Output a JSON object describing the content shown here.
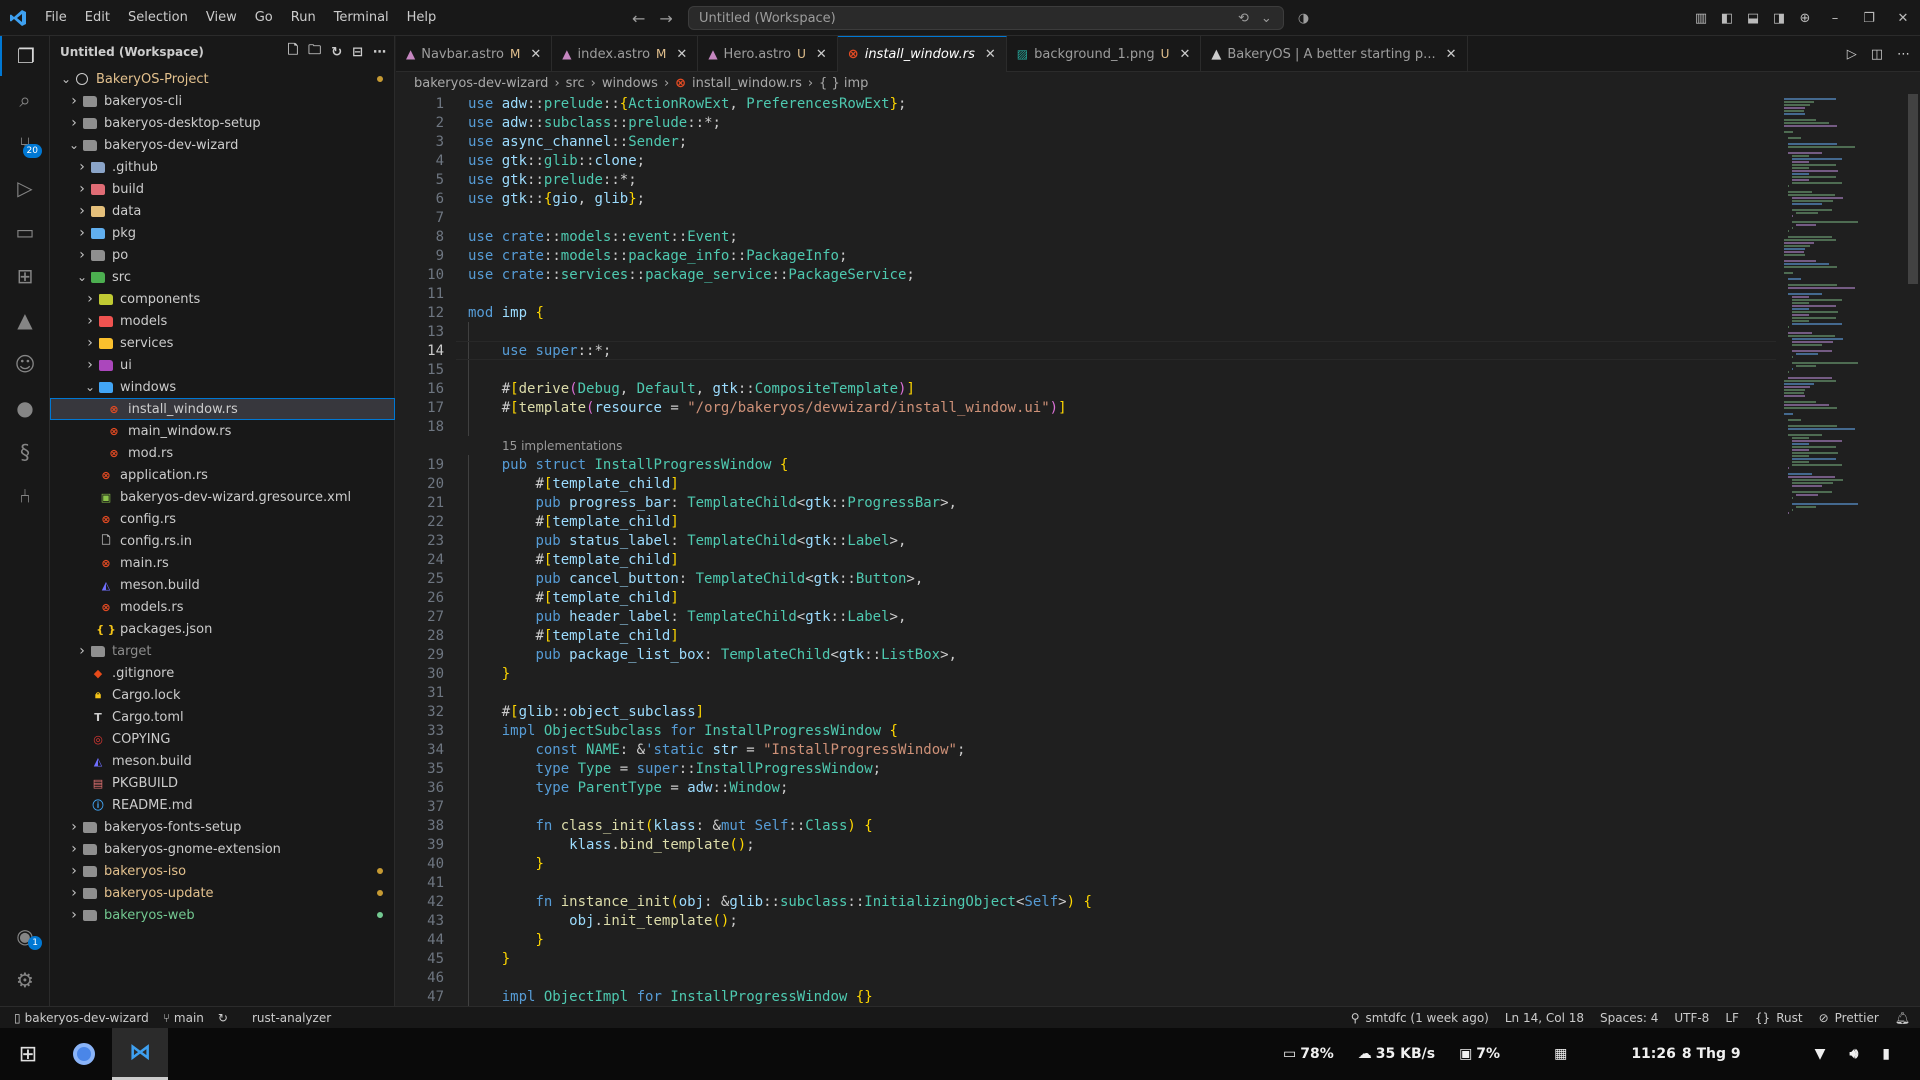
{
  "titlebar": {
    "menus": [
      "File",
      "Edit",
      "Selection",
      "View",
      "Go",
      "Run",
      "Terminal",
      "Help"
    ],
    "command_center": "Untitled (Workspace)"
  },
  "activity": {
    "source_control_badge": "20",
    "account_badge": "1"
  },
  "sidebar": {
    "title": "Untitled (Workspace)",
    "tree": [
      {
        "label": "BakeryOS-Project",
        "depth": 0,
        "kind": "root",
        "open": true,
        "color": "#e2c08d",
        "dot": true
      },
      {
        "label": "bakeryos-cli",
        "depth": 1,
        "kind": "folder",
        "open": false
      },
      {
        "label": "bakeryos-desktop-setup",
        "depth": 1,
        "kind": "folder",
        "open": false
      },
      {
        "label": "bakeryos-dev-wizard",
        "depth": 1,
        "kind": "folder",
        "open": true
      },
      {
        "label": ".github",
        "depth": 2,
        "kind": "folder",
        "open": false,
        "fcolor": "#8aa4c8"
      },
      {
        "label": "build",
        "depth": 2,
        "kind": "folder",
        "open": false,
        "fcolor": "#e06c75"
      },
      {
        "label": "data",
        "depth": 2,
        "kind": "folder",
        "open": false,
        "fcolor": "#e5c07b"
      },
      {
        "label": "pkg",
        "depth": 2,
        "kind": "folder",
        "open": false,
        "fcolor": "#61afef"
      },
      {
        "label": "po",
        "depth": 2,
        "kind": "folder",
        "open": false
      },
      {
        "label": "src",
        "depth": 2,
        "kind": "folder",
        "open": true,
        "fcolor": "#4caf50"
      },
      {
        "label": "components",
        "depth": 3,
        "kind": "folder",
        "open": false,
        "fcolor": "#c0ca33"
      },
      {
        "label": "models",
        "depth": 3,
        "kind": "folder",
        "open": false,
        "fcolor": "#ef5350"
      },
      {
        "label": "services",
        "depth": 3,
        "kind": "folder",
        "open": false,
        "fcolor": "#fbc02d"
      },
      {
        "label": "ui",
        "depth": 3,
        "kind": "folder",
        "open": false,
        "fcolor": "#ab47bc"
      },
      {
        "label": "windows",
        "depth": 3,
        "kind": "folder",
        "open": true,
        "fcolor": "#42a5f5"
      },
      {
        "label": "install_window.rs",
        "depth": 4,
        "kind": "rs",
        "selected": true
      },
      {
        "label": "main_window.rs",
        "depth": 4,
        "kind": "rs"
      },
      {
        "label": "mod.rs",
        "depth": 4,
        "kind": "rs"
      },
      {
        "label": "application.rs",
        "depth": 3,
        "kind": "rs"
      },
      {
        "label": "bakeryos-dev-wizard.gresource.xml",
        "depth": 3,
        "kind": "xml"
      },
      {
        "label": "config.rs",
        "depth": 3,
        "kind": "rs"
      },
      {
        "label": "config.rs.in",
        "depth": 3,
        "kind": "file"
      },
      {
        "label": "main.rs",
        "depth": 3,
        "kind": "rs"
      },
      {
        "label": "meson.build",
        "depth": 3,
        "kind": "meson"
      },
      {
        "label": "models.rs",
        "depth": 3,
        "kind": "rs"
      },
      {
        "label": "packages.json",
        "depth": 3,
        "kind": "json"
      },
      {
        "label": "target",
        "depth": 2,
        "kind": "folder",
        "open": false,
        "dim": true
      },
      {
        "label": ".gitignore",
        "depth": 2,
        "kind": "git"
      },
      {
        "label": "Cargo.lock",
        "depth": 2,
        "kind": "lock"
      },
      {
        "label": "Cargo.toml",
        "depth": 2,
        "kind": "toml"
      },
      {
        "label": "COPYING",
        "depth": 2,
        "kind": "license"
      },
      {
        "label": "meson.build",
        "depth": 2,
        "kind": "meson"
      },
      {
        "label": "PKGBUILD",
        "depth": 2,
        "kind": "pkgbuild"
      },
      {
        "label": "README.md",
        "depth": 2,
        "kind": "info"
      },
      {
        "label": "bakeryos-fonts-setup",
        "depth": 1,
        "kind": "folder",
        "open": false
      },
      {
        "label": "bakeryos-gnome-extension",
        "depth": 1,
        "kind": "folder",
        "open": false
      },
      {
        "label": "bakeryos-iso",
        "depth": 1,
        "kind": "folder",
        "open": false,
        "color": "#e2c08d",
        "dot": true
      },
      {
        "label": "bakeryos-update",
        "depth": 1,
        "kind": "folder",
        "open": false,
        "color": "#e2c08d",
        "dot": true
      },
      {
        "label": "bakeryos-web",
        "depth": 1,
        "kind": "folder",
        "open": false,
        "color": "#73c991",
        "dot": true,
        "dotcolor": "#73c991"
      }
    ]
  },
  "tabs": [
    {
      "label": "Navbar.astro",
      "status": "M",
      "icon": "astro"
    },
    {
      "label": "index.astro",
      "status": "M",
      "icon": "astro"
    },
    {
      "label": "Hero.astro",
      "status": "U",
      "icon": "astro"
    },
    {
      "label": "install_window.rs",
      "status": "",
      "icon": "rust",
      "active": true
    },
    {
      "label": "background_1.png",
      "status": "U",
      "icon": "png"
    },
    {
      "label": "BakeryOS | A better starting p...",
      "status": "",
      "icon": "astro-logo"
    }
  ],
  "breadcrumb": [
    "bakeryos-dev-wizard",
    "src",
    "windows",
    "install_window.rs",
    "{ } imp"
  ],
  "editor": {
    "current_line": 14,
    "codelens_text": "15 implementations",
    "lines": [
      "use adw::prelude::{ActionRowExt, PreferencesRowExt};",
      "use adw::subclass::prelude::*;",
      "use async_channel::Sender;",
      "use gtk::glib::clone;",
      "use gtk::prelude::*;",
      "use gtk::{gio, glib};",
      "",
      "use crate::models::event::Event;",
      "use crate::models::package_info::PackageInfo;",
      "use crate::services::package_service::PackageService;",
      "",
      "mod imp {",
      "",
      "    use super::*;",
      "",
      "    #[derive(Debug, Default, gtk::CompositeTemplate)]",
      "    #[template(resource = \"/org/bakeryos/devwizard/install_window.ui\")]",
      "",
      "    pub struct InstallProgressWindow {",
      "        #[template_child]",
      "        pub progress_bar: TemplateChild<gtk::ProgressBar>,",
      "        #[template_child]",
      "        pub status_label: TemplateChild<gtk::Label>,",
      "        #[template_child]",
      "        pub cancel_button: TemplateChild<gtk::Button>,",
      "        #[template_child]",
      "        pub header_label: TemplateChild<gtk::Label>,",
      "        #[template_child]",
      "        pub package_list_box: TemplateChild<gtk::ListBox>,",
      "    }",
      "",
      "    #[glib::object_subclass]",
      "    impl ObjectSubclass for InstallProgressWindow {",
      "        const NAME: &'static str = \"InstallProgressWindow\";",
      "        type Type = super::InstallProgressWindow;",
      "        type ParentType = adw::Window;",
      "",
      "        fn class_init(klass: &mut Self::Class) {",
      "            klass.bind_template();",
      "        }",
      "",
      "        fn instance_init(obj: &glib::subclass::InitializingObject<Self>) {",
      "            obj.init_template();",
      "        }",
      "    }",
      "",
      "    impl ObjectImpl for InstallProgressWindow {}"
    ]
  },
  "statusbar": {
    "left": [
      "bakeryos-dev-wizard",
      "main",
      "rust-analyzer"
    ],
    "right": [
      "smtdfc (1 week ago)",
      "Ln 14, Col 18",
      "Spaces: 4",
      "UTF-8",
      "LF",
      "Rust",
      "Prettier"
    ]
  },
  "taskbar": {
    "battery": "78%",
    "network": "35 KB/s",
    "cpu": "7%",
    "time": "11:26",
    "date": "8 Thg 9"
  }
}
